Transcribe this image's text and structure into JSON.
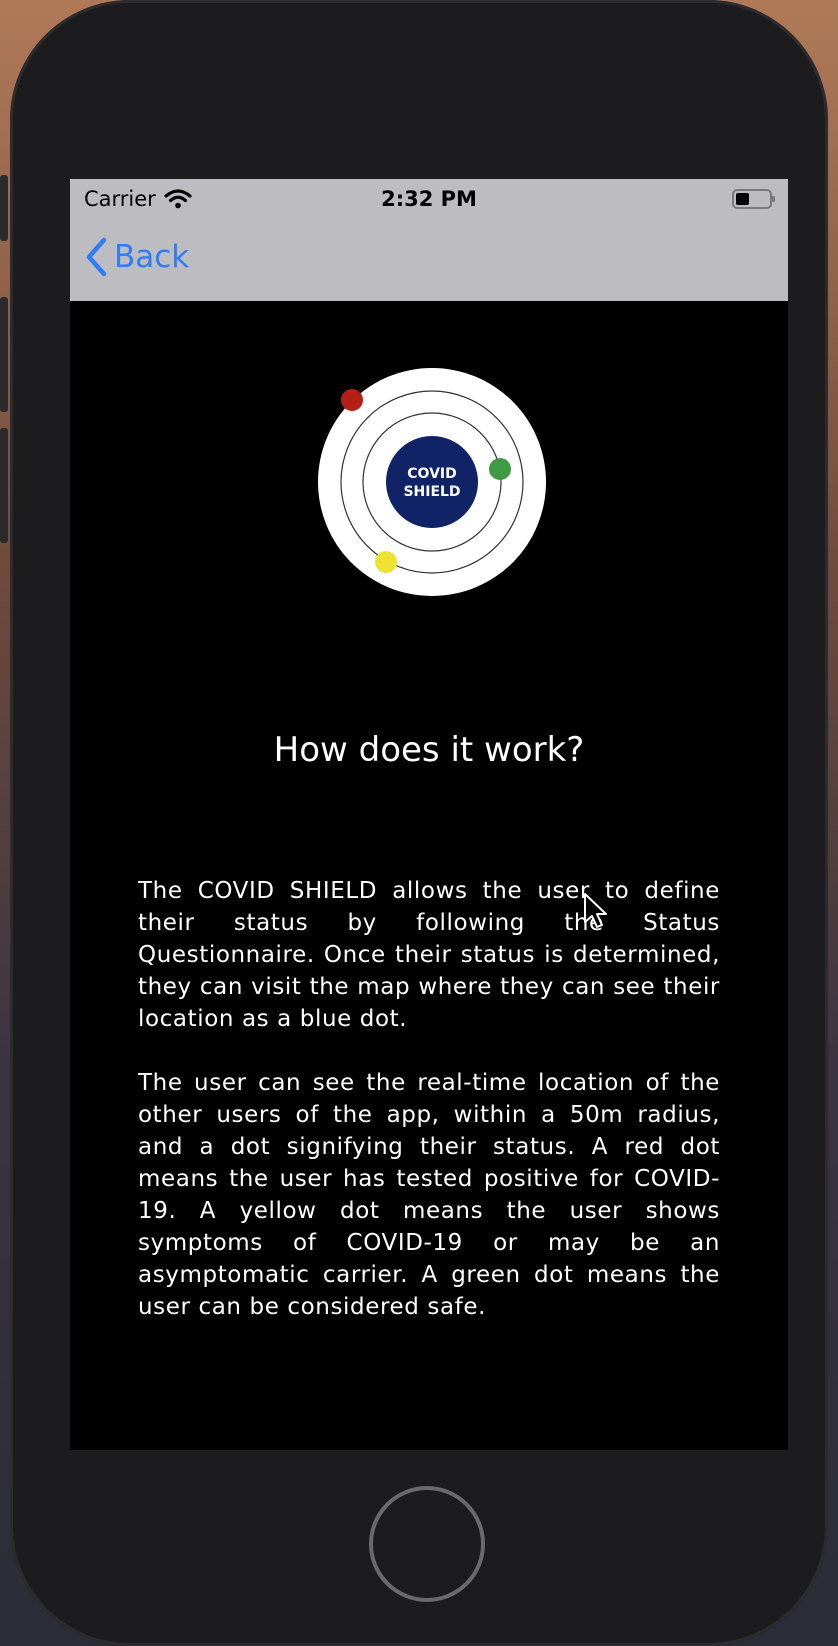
{
  "status_bar": {
    "carrier": "Carrier",
    "time": "2:32 PM",
    "battery_level": 0.4
  },
  "nav": {
    "back_label": "Back",
    "accent_color": "#2f7cf6"
  },
  "logo": {
    "line1": "COVID",
    "line2": "SHIELD",
    "center_color": "#0f2366",
    "dot_colors": {
      "red": "#b51f16",
      "green": "#3f9a44",
      "yellow": "#efe332"
    }
  },
  "content": {
    "heading": "How does it work?",
    "paragraphs": [
      "The COVID SHIELD allows the user to define their status by following the Status Questionnaire. Once their status is determined, they can visit the map where they can see their location as a blue dot.",
      "The user can see the real-time location of the other users of the app, within a 50m radius, and a dot signifying their status. A red dot means the user has tested positive for COVID-19. A yellow dot means the user shows symptoms of COVID-19 or may be an asymptomatic carrier. A green dot means the user can be considered safe."
    ]
  }
}
